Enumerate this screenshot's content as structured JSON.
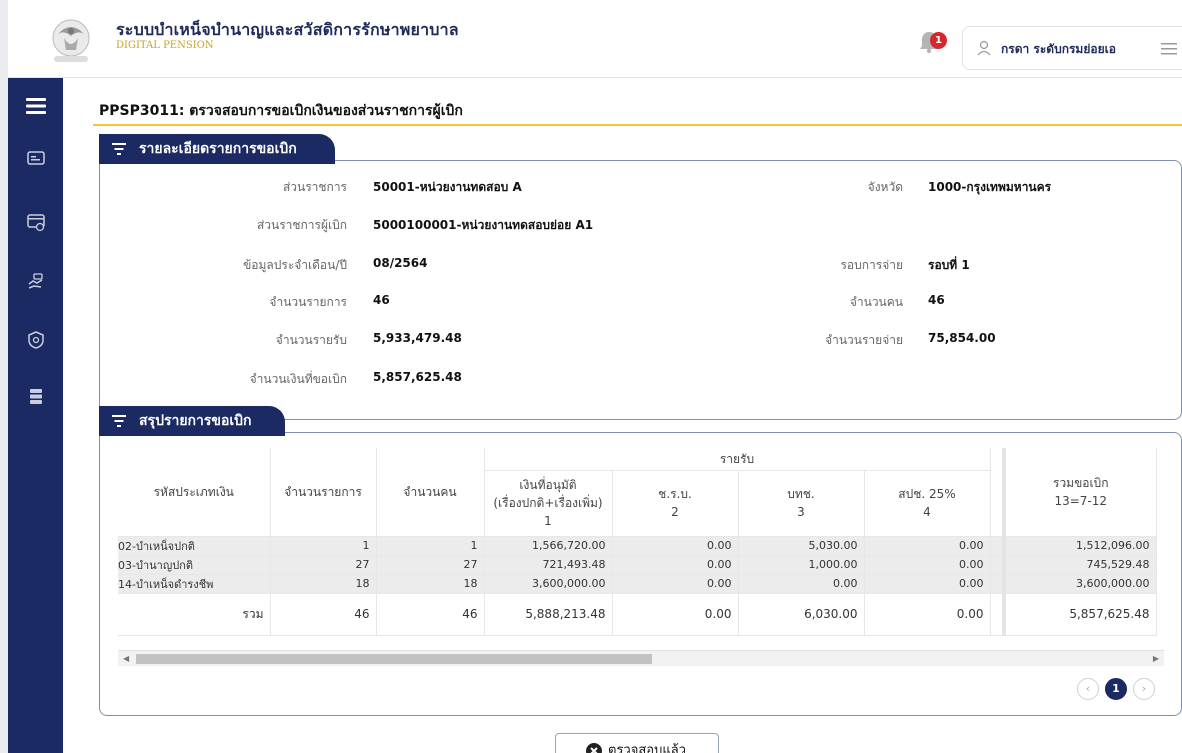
{
  "header": {
    "title": "ระบบบำเหน็จบำนาญและสวัสดิการรักษาพยาบาล",
    "subtitle": "DIGITAL PENSION",
    "notification_count": "1",
    "user_name": "กรดา ระดับกรมย่อยเอ"
  },
  "page": {
    "title": "PPSP3011: ตรวจสอบการขอเบิกเงินของส่วนราชการผู้เบิก"
  },
  "details": {
    "section_title": "รายละเอียดรายการขอเบิก",
    "fields": {
      "agency_label": "ส่วนราชการ",
      "agency_value": "50001-หน่วยงานทดสอบ A",
      "province_label": "จังหวัด",
      "province_value": "1000-กรุงเทพมหานคร",
      "disbursing_label": "ส่วนราชการผู้เบิก",
      "disbursing_value": "5000100001-หน่วยงานทดสอบย่อย A1",
      "month_label": "ข้อมูลประจำเดือน/ปี",
      "month_value": "08/2564",
      "round_label": "รอบการจ่าย",
      "round_value": "รอบที่ 1",
      "items_label": "จำนวนรายการ",
      "items_value": "46",
      "persons_label": "จำนวนคน",
      "persons_value": "46",
      "income_label": "จำนวนรายรับ",
      "income_value": "5,933,479.48",
      "expense_label": "จำนวนรายจ่าย",
      "expense_value": "75,854.00",
      "request_label": "จำนวนเงินที่ขอเบิก",
      "request_value": "5,857,625.48"
    }
  },
  "summary": {
    "section_title": "สรุปรายการขอเบิก",
    "headers": {
      "type_code": "รหัสประเภทเงิน",
      "items": "จำนวนรายการ",
      "persons": "จำนวนคน",
      "income_group": "รายรับ",
      "approved_line1": "เงินที่อนุมัติ",
      "approved_line2": "(เรื่องปกติ+เรื่องเพิ่ม)",
      "approved_num": "1",
      "cso": "ช.ร.บ.",
      "cso_num": "2",
      "bth": "บทช.",
      "bth_num": "3",
      "spch": "สปช. 25%",
      "spch_num": "4",
      "total_req": "รวมขอเบิก",
      "total_req_formula": "13=7-12"
    },
    "rows": [
      {
        "type": "02-บำเหน็จปกติ",
        "items": "1",
        "persons": "1",
        "approved": "1,566,720.00",
        "cso": "0.00",
        "bth": "5,030.00",
        "spch": "0.00",
        "total": "1,512,096.00"
      },
      {
        "type": "03-บำนาญปกติ",
        "items": "27",
        "persons": "27",
        "approved": "721,493.48",
        "cso": "0.00",
        "bth": "1,000.00",
        "spch": "0.00",
        "total": "745,529.48"
      },
      {
        "type": "14-บำเหน็จดำรงชีพ",
        "items": "18",
        "persons": "18",
        "approved": "3,600,000.00",
        "cso": "0.00",
        "bth": "0.00",
        "spch": "0.00",
        "total": "3,600,000.00"
      }
    ],
    "total_row": {
      "label": "รวม",
      "items": "46",
      "persons": "46",
      "approved": "5,888,213.48",
      "cso": "0.00",
      "bth": "6,030.00",
      "spch": "0.00",
      "total": "5,857,625.48"
    },
    "page_current": "1"
  },
  "actions": {
    "confirm_label": "ตรวจสอบแล้ว"
  },
  "colors": {
    "navy": "#1b2a63",
    "accent_yellow": "#f3c53c",
    "badge_red": "#d9262c"
  }
}
